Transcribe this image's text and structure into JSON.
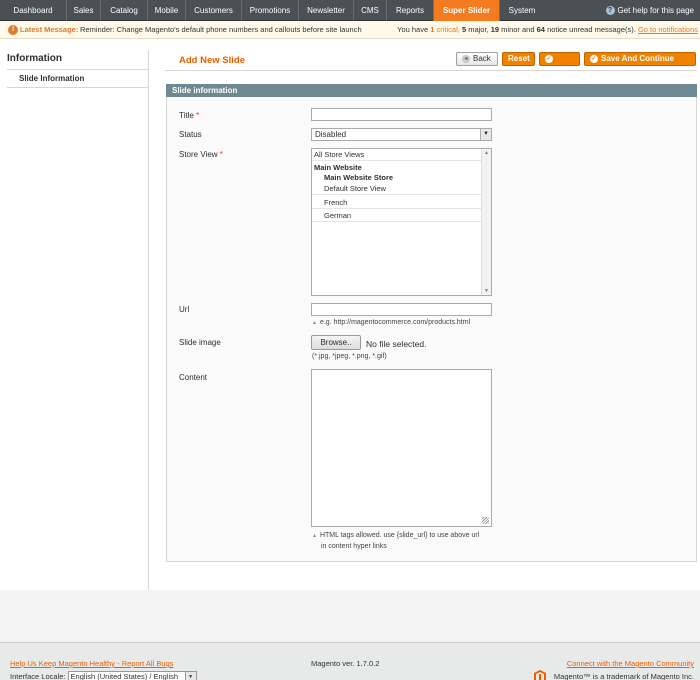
{
  "nav": {
    "items": [
      "Dashboard",
      "Sales",
      "Catalog",
      "Mobile",
      "Customers",
      "Promotions",
      "Newsletter",
      "CMS",
      "Reports",
      "Super Slider",
      "System"
    ],
    "active_index": 9,
    "help_label": "Get help for this page"
  },
  "notice": {
    "label": "Latest Message:",
    "message": "Reminder: Change Magento's default phone numbers and callouts before site launch",
    "summary_pre": "You have",
    "critical_count": "1",
    "critical_label": "critical,",
    "major_count": "5",
    "major_label": "major,",
    "minor_count": "19",
    "minor_label": "minor and",
    "notice_count": "64",
    "notice_label": "notice unread message(s).",
    "link": "Go to notifications"
  },
  "sidebar": {
    "title": "Information",
    "tabs": [
      "Slide Information"
    ]
  },
  "page": {
    "title": "Add New Slide",
    "buttons": {
      "back": "Back",
      "reset": "Reset",
      "save": "Save",
      "save_continue": "Save And Continue Edit"
    }
  },
  "form": {
    "section_title": "Slide information",
    "title_label": "Title",
    "title_value": "",
    "status_label": "Status",
    "status_value": "Disabled",
    "store_view_label": "Store View",
    "store_options": [
      "All Store Views",
      "Main Website",
      "Main Website Store",
      "Default Store View",
      "French",
      "German"
    ],
    "url_label": "Url",
    "url_value": "",
    "url_note": "e.g. http://magentocommerce.com/products.html",
    "image_label": "Slide image",
    "browse_label": "Browse..",
    "no_file": "No file selected.",
    "image_note": "(*.jpg, *jpeg, *.png, *.gif)",
    "content_label": "Content",
    "content_value": "",
    "content_note_1": "HTML tags allowed. use {slide_url} to use above url",
    "content_note_2": "in content hyper links"
  },
  "footer": {
    "help_link": "Help Us Keep Magento Healthy - Report All Bugs",
    "version": "Magento ver. 1.7.0.2",
    "community_link": "Connect with the Magento Community",
    "locale_label": "Interface Locale:",
    "locale_value": "English (United States) / English",
    "trademark": "Magento™ is a trademark of Magento Inc."
  },
  "colors": {
    "accent": "#eb5e00",
    "nav_bg": "#4a5053",
    "active_tab": "#f47b20",
    "fieldset_head": "#6f8992"
  }
}
